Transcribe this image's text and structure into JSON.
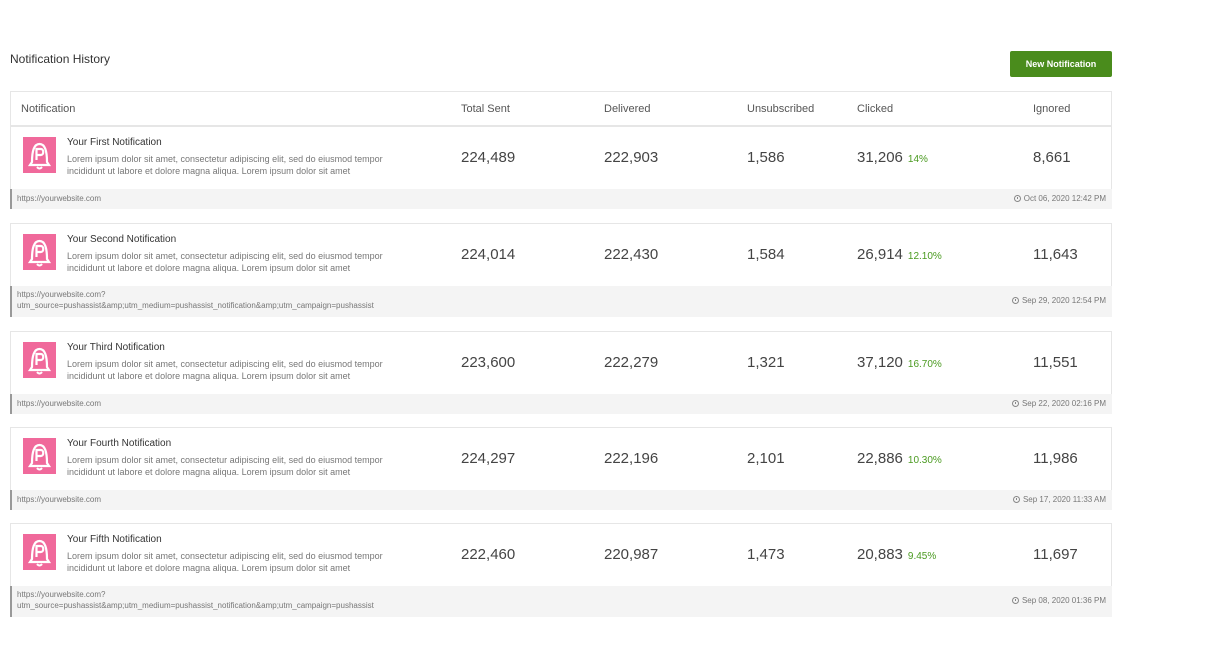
{
  "page": {
    "title": "Notification History",
    "new_button": "New Notification"
  },
  "columns": {
    "notification": "Notification",
    "total_sent": "Total Sent",
    "delivered": "Delivered",
    "unsubscribed": "Unsubscribed",
    "clicked": "Clicked",
    "ignored": "Ignored"
  },
  "rows": [
    {
      "title": "Your First Notification",
      "description": "Lorem ipsum dolor sit amet, consectetur adipiscing elit, sed do eiusmod tempor incididunt ut labore et dolore magna aliqua. Lorem ipsum dolor sit amet",
      "total_sent": "224,489",
      "delivered": "222,903",
      "unsubscribed": "1,586",
      "clicked": "31,206",
      "clicked_pct": "14%",
      "ignored": "8,661",
      "url": "https://yourwebsite.com",
      "time": "Oct 06, 2020 12:42 PM"
    },
    {
      "title": "Your Second Notification",
      "description": "Lorem ipsum dolor sit amet, consectetur adipiscing elit, sed do eiusmod tempor incididunt ut labore et dolore magna aliqua. Lorem ipsum dolor sit amet",
      "total_sent": "224,014",
      "delivered": "222,430",
      "unsubscribed": "1,584",
      "clicked": "26,914",
      "clicked_pct": "12.10%",
      "ignored": "11,643",
      "url": "https://yourwebsite.com?\nutm_source=pushassist&amp;utm_medium=pushassist_notification&amp;utm_campaign=pushassist",
      "time": "Sep 29, 2020 12:54 PM"
    },
    {
      "title": "Your Third Notification",
      "description": "Lorem ipsum dolor sit amet, consectetur adipiscing elit, sed do eiusmod tempor incididunt ut labore et dolore magna aliqua. Lorem ipsum dolor sit amet",
      "total_sent": "223,600",
      "delivered": "222,279",
      "unsubscribed": "1,321",
      "clicked": "37,120",
      "clicked_pct": "16.70%",
      "ignored": "11,551",
      "url": "https://yourwebsite.com",
      "time": "Sep 22, 2020 02:16 PM"
    },
    {
      "title": "Your Fourth Notification",
      "description": "Lorem ipsum dolor sit amet, consectetur adipiscing elit, sed do eiusmod tempor incididunt ut labore et dolore magna aliqua. Lorem ipsum dolor sit amet",
      "total_sent": "224,297",
      "delivered": "222,196",
      "unsubscribed": "2,101",
      "clicked": "22,886",
      "clicked_pct": "10.30%",
      "ignored": "11,986",
      "url": "https://yourwebsite.com",
      "time": "Sep 17, 2020 11:33 AM"
    },
    {
      "title": "Your Fifth Notification",
      "description": "Lorem ipsum dolor sit amet, consectetur adipiscing elit, sed do eiusmod tempor incididunt ut labore et dolore magna aliqua. Lorem ipsum dolor sit amet",
      "total_sent": "222,460",
      "delivered": "220,987",
      "unsubscribed": "1,473",
      "clicked": "20,883",
      "clicked_pct": "9.45%",
      "ignored": "11,697",
      "url": "https://yourwebsite.com?\nutm_source=pushassist&amp;utm_medium=pushassist_notification&amp;utm_campaign=pushassist",
      "time": "Sep 08, 2020 01:36 PM"
    }
  ],
  "icons": {
    "row_logo": "pushassist-bell-logo-icon",
    "time": "clock-icon"
  },
  "colors": {
    "accent": "#4a8c1c",
    "percent": "#4a9a20",
    "logo": "#f0699b"
  }
}
